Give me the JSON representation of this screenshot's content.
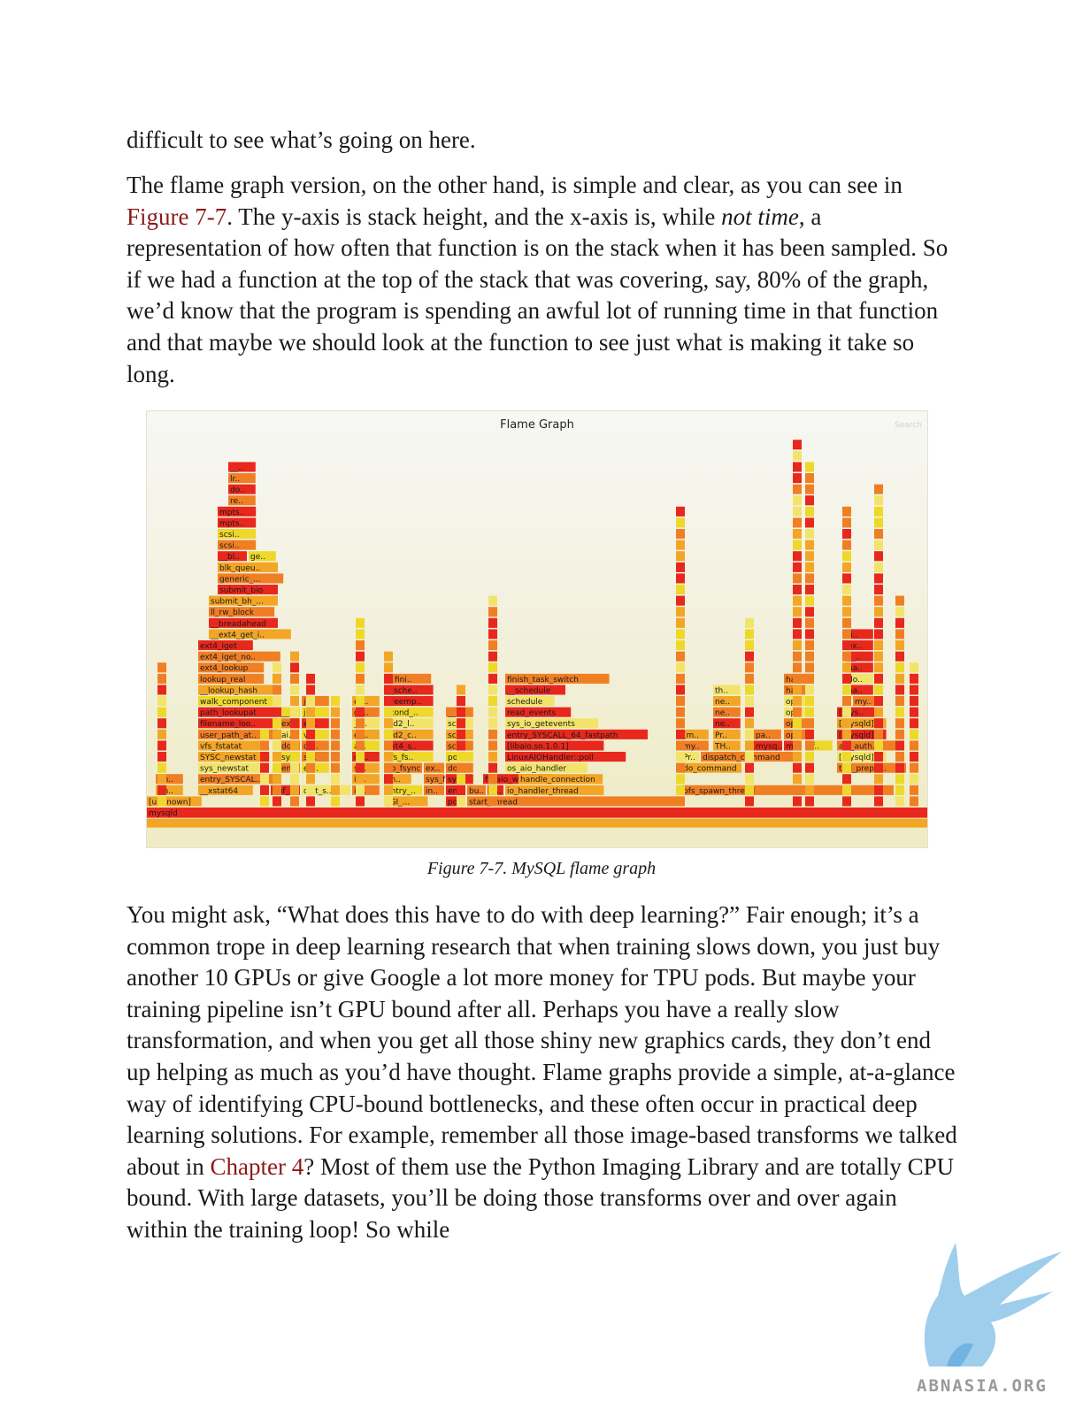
{
  "text": {
    "p0": "difficult to see what’s going on here.",
    "p1_a": "The flame graph version, on the other hand, is simple and clear, as you can see in ",
    "p1_link": "Figure 7-7",
    "p1_b": ". The y-axis is stack height, and the x-axis is, while ",
    "p1_em": "not time",
    "p1_c": ", a representation of how often that function is on the stack when it has been sampled. So if we had a function at the top of the stack that was covering, say, 80% of the graph, we’d know that the program is spending an awful lot of running time in that function and that maybe we should look at the function to see just what is making it take so long.",
    "p2_a": "You might ask, “What does this have to do with deep learning?” Fair enough; it’s a common trope in deep learning research that when training slows down, you just buy another 10 GPUs or give Google a lot more money for TPU pods. But maybe your training pipeline isn’t GPU bound after all. Perhaps you have a really slow transformation, and when you get all those shiny new graphics cards, they don’t end up helping as much as you’d have thought. Flame graphs provide a simple, at-a-glance way of identifying CPU-bound bottlenecks, and these often occur in practical deep learning solutions. For example, remember all those image-based transforms we talked about in ",
    "p2_link": "Chapter 4",
    "p2_b": "? Most of them use the Python Imaging Library and are totally CPU bound. With large datasets, you’ll be doing those transforms over and over again within the training loop! So while"
  },
  "figure": {
    "title": "Flame Graph",
    "search_label": "Search",
    "caption": "Figure 7-7. MySQL flame graph",
    "colors": {
      "red": "#e8281d",
      "orange": "#f07f24",
      "yellow": "#eed82a",
      "amber": "#f3a526",
      "pale": "#f2e46a"
    },
    "rows_from_bottom": [
      [
        "mysqld"
      ],
      [
        "[unknown]",
        "_GI_...",
        "poll",
        "start_thread"
      ],
      [
        "[m..",
        "__xstat64",
        "buf_..",
        "dict_s..",
        "io..",
        "entry_..",
        "in..",
        "en..",
        "bu..",
        "di..",
        "io_handler_thread",
        "pfs_spawn_thread"
      ],
      [
        "[m..",
        "entry_SYSCAL..",
        "io..",
        "en..",
        "sys_fs..",
        "sy..",
        "sy..",
        "di..",
        "fil_aio_wait",
        "handle_connection"
      ],
      [
        "sys_newstat",
        "en..",
        "en..",
        "sy..",
        "do_fsync",
        "ex..",
        "do..",
        "os_aio_handler",
        "do_command",
        "thd_prepar.."
      ],
      [
        "SYSC_newstat",
        "sy..",
        "sy..",
        "do..",
        "vfs_fs..",
        "po..",
        "LinuxAIOHandler::poll",
        "Pr..",
        "dispatch_command",
        "[mysqld]"
      ],
      [
        "vfs_fstatat",
        "do..",
        "do..",
        "ai..",
        "ext4_s..",
        "sc..",
        "[libaio.so.1.0.1]",
        "my..",
        "TH..",
        "mysq..",
        "my",
        "pf..",
        "acl_auth.."
      ],
      [
        "user_path_at..",
        "ai..",
        "vf..",
        "ex..",
        "jbd2_c..",
        "sc..",
        "entry_SYSCALL_64_fastpath",
        "[m..",
        "Pr..",
        "pa..",
        "op..",
        "[mysqld]"
      ],
      [
        "filename_loo..",
        "ex..",
        "ex..",
        "__..",
        "jbd2_l..",
        "sc..",
        "sys_io_getevents",
        "ne..",
        "op..",
        "[mysqld]"
      ],
      [
        "path_lookupat",
        "__..",
        "jb..",
        "ge..",
        "_cond_..",
        "__..",
        "read_events",
        "ne..",
        "op..",
        "[mys.."
      ],
      [
        "walk_component",
        "jb..",
        "ex..",
        "preemp..",
        "schedule",
        "ne..",
        "op..",
        "my.."
      ],
      [
        "__lookup_hash",
        "__sche..",
        "__schedule",
        "th..",
        "ha..",
        "pa.."
      ],
      [
        "lookup_real",
        "fini..",
        "finish_task_switch",
        "ha..",
        "do.."
      ],
      [
        "ext4_lookup",
        "ha.."
      ],
      [
        "ext4_iget_no..",
        "__.."
      ],
      [
        "ext4_iget",
        "ex.."
      ],
      [
        "__ext4_get_i..",
        "fi.."
      ],
      [
        "__breadahead"
      ],
      [
        "ll_rw_block"
      ],
      [
        "submit_bh_..."
      ],
      [
        "submit_bio"
      ],
      [
        "generic_..."
      ],
      [
        "blk_queu.."
      ],
      [
        "__bl..",
        "ge.."
      ],
      [
        "scsi.."
      ],
      [
        "scsi.."
      ],
      [
        "mpts.."
      ],
      [
        "mpts.."
      ],
      [
        "re.."
      ],
      [
        "do.."
      ],
      [
        "lr.."
      ],
      [
        "__.."
      ]
    ]
  },
  "watermark": {
    "text": "ABNASIA.ORG"
  }
}
